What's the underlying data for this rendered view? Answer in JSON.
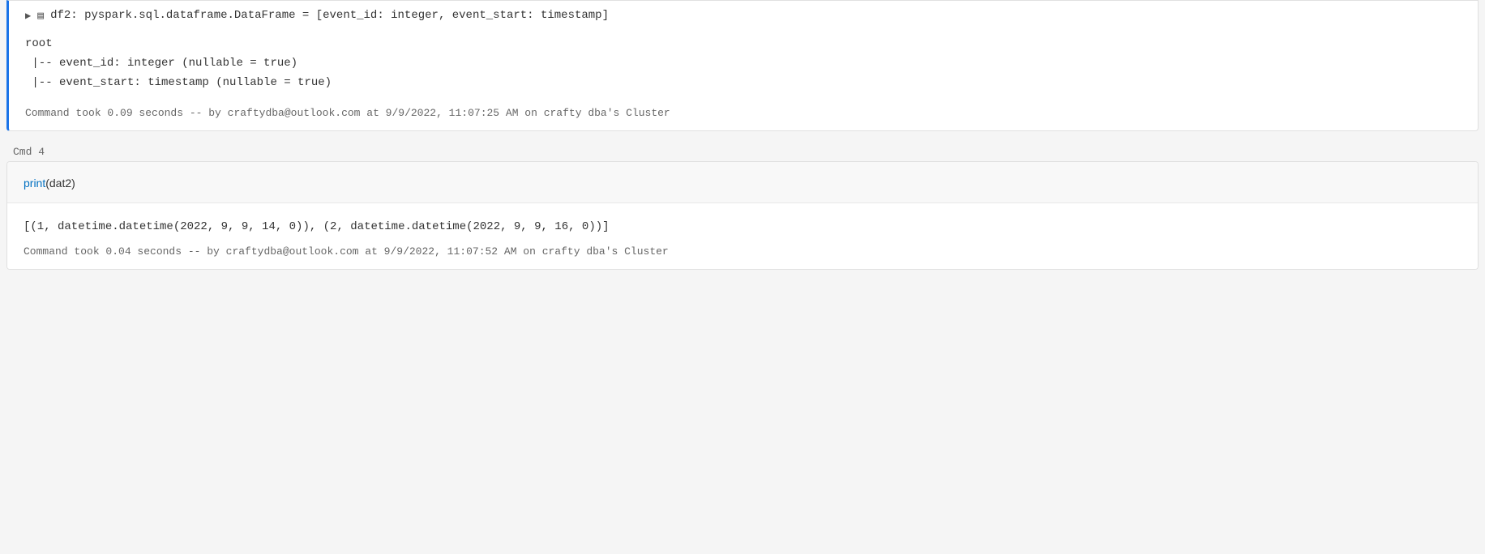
{
  "cells": [
    {
      "id": "cell3",
      "label": "",
      "df_line": {
        "arrow": "▶",
        "icon": "≡",
        "text": "df2:  pyspark.sql.dataframe.DataFrame = [event_id: integer, event_start: timestamp]"
      },
      "schema": "root\n |-- event_id: integer (nullable = true)\n |-- event_start: timestamp (nullable = true)",
      "timing": "Command took 0.09 seconds -- by craftydba@outlook.com at 9/9/2022, 11:07:25 AM on crafty dba's Cluster"
    },
    {
      "id": "cell4",
      "label": "Cmd 4",
      "code": {
        "keyword": "print",
        "args": "(dat2)"
      },
      "output": "[(1, datetime.datetime(2022, 9, 9, 14, 0)), (2, datetime.datetime(2022, 9, 9, 16, 0))]",
      "timing": "Command took 0.04 seconds -- by craftydba@outlook.com at 9/9/2022, 11:07:52 AM on crafty dba's Cluster"
    }
  ]
}
